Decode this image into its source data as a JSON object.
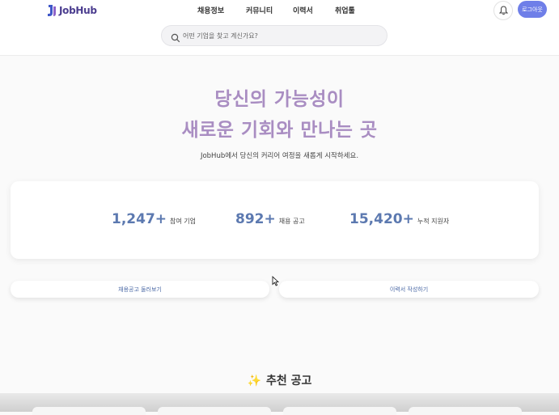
{
  "app": {
    "logo_text": "JobHub"
  },
  "nav": {
    "items": [
      "채용정보",
      "커뮤니티",
      "이력서",
      "취업툴"
    ]
  },
  "header": {
    "login_label": "로그아웃",
    "bell_icon": "bell-icon"
  },
  "search": {
    "placeholder": "어떤 기업을 찾고 계신가요?",
    "icon": "search-icon"
  },
  "hero": {
    "line1": "당신의 가능성이",
    "line2": "새로운 기회와 만나는 곳",
    "subtitle": "JobHub에서 당신의 커리어 여정을 새롭게 시작하세요."
  },
  "stats": [
    {
      "value": "1,247+",
      "label": "참여 기업"
    },
    {
      "value": "892+",
      "label": "채용 공고"
    },
    {
      "value": "15,420+",
      "label": "누적 지원자"
    }
  ],
  "actions": {
    "browse_jobs": "채용공고 둘러보기",
    "write_resume": "이력서 작성하기"
  },
  "recommended": {
    "icon": "✨",
    "title": "추천 공고"
  },
  "colors": {
    "accent": "#6f7fe8",
    "hero_text": "#a98dc2",
    "stat_value": "#5c79b0",
    "logo": "#4b3d8f"
  }
}
